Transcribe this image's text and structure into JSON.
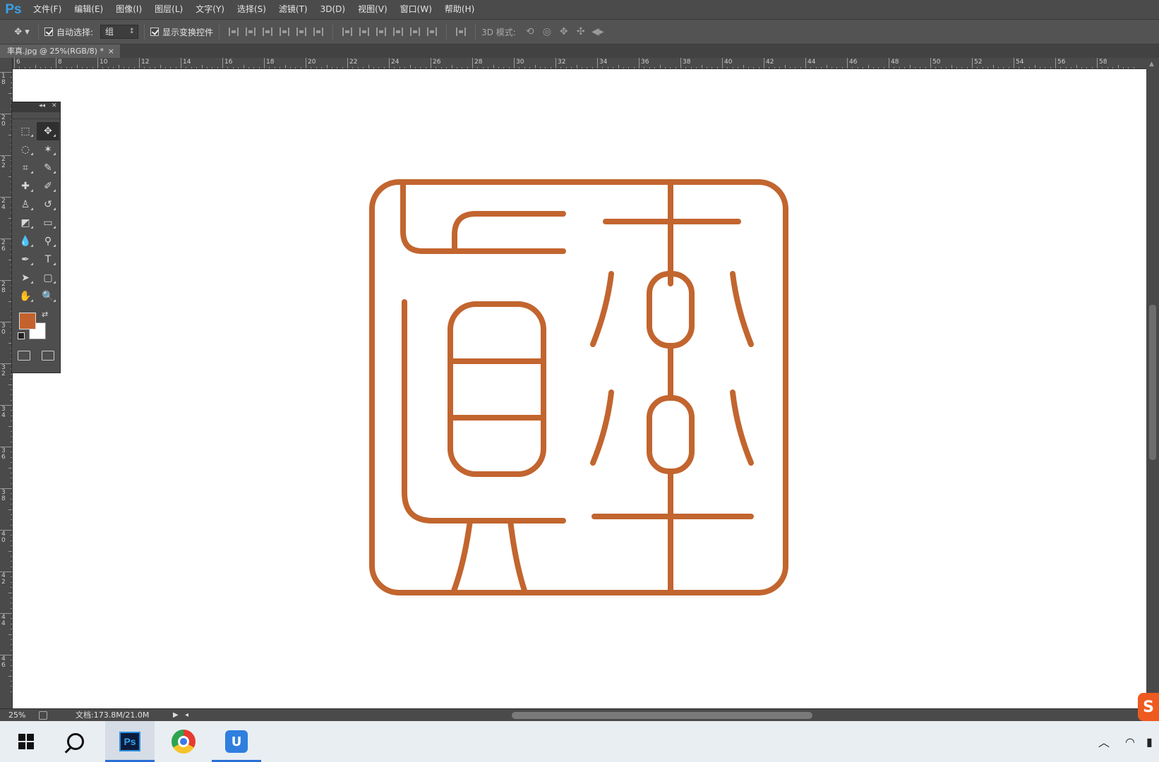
{
  "app": {
    "logo": "Ps",
    "menus": [
      "文件(F)",
      "编辑(E)",
      "图像(I)",
      "图层(L)",
      "文字(Y)",
      "选择(S)",
      "滤镜(T)",
      "3D(D)",
      "视图(V)",
      "窗口(W)",
      "帮助(H)"
    ]
  },
  "options": {
    "auto_select_label": "自动选择:",
    "auto_select_value": "组",
    "show_transform_label": "显示变换控件",
    "mode3d_label": "3D 模式:"
  },
  "document": {
    "tab_title": "率真.jpg @ 25%(RGB/8) *",
    "tab_close": "×"
  },
  "rulers": {
    "horizontal": [
      "6",
      "8",
      "10",
      "12",
      "14",
      "16",
      "18",
      "20",
      "22",
      "24",
      "26",
      "28",
      "30",
      "32",
      "34",
      "36",
      "38",
      "40",
      "42",
      "44",
      "46",
      "48",
      "50",
      "52",
      "54",
      "56",
      "58"
    ],
    "vertical": [
      "18",
      "20",
      "22",
      "24",
      "26",
      "28",
      "30",
      "32",
      "34",
      "36",
      "38",
      "40",
      "42",
      "44",
      "46"
    ]
  },
  "colors": {
    "seal": "#c2652f",
    "foreground": "#c4622e",
    "background": "#ffffff",
    "ui_dark": "#535353",
    "accent_blue": "#2a6fd6"
  },
  "tools": [
    {
      "name": "marquee-tool-icon",
      "glyph": "⬚"
    },
    {
      "name": "move-tool-icon",
      "glyph": "✥",
      "active": true
    },
    {
      "name": "lasso-tool-icon",
      "glyph": "◌"
    },
    {
      "name": "magic-wand-tool-icon",
      "glyph": "✶"
    },
    {
      "name": "crop-tool-icon",
      "glyph": "⌗"
    },
    {
      "name": "eyedropper-tool-icon",
      "glyph": "✎"
    },
    {
      "name": "healing-brush-tool-icon",
      "glyph": "✚"
    },
    {
      "name": "brush-tool-icon",
      "glyph": "✐"
    },
    {
      "name": "clone-stamp-tool-icon",
      "glyph": "♙"
    },
    {
      "name": "history-brush-tool-icon",
      "glyph": "↺"
    },
    {
      "name": "eraser-tool-icon",
      "glyph": "◩"
    },
    {
      "name": "gradient-tool-icon",
      "glyph": "▭"
    },
    {
      "name": "blur-tool-icon",
      "glyph": "💧"
    },
    {
      "name": "dodge-tool-icon",
      "glyph": "⚲"
    },
    {
      "name": "pen-tool-icon",
      "glyph": "✒"
    },
    {
      "name": "type-tool-icon",
      "glyph": "T"
    },
    {
      "name": "path-selection-tool-icon",
      "glyph": "➤"
    },
    {
      "name": "shape-tool-icon",
      "glyph": "▢"
    },
    {
      "name": "hand-tool-icon",
      "glyph": "✋"
    },
    {
      "name": "zoom-tool-icon",
      "glyph": "🔍"
    }
  ],
  "status": {
    "zoom": "25%",
    "doc_info": "文档:173.8M/21.0M"
  },
  "taskbar": {
    "ps_label": "Ps",
    "u_label": "U",
    "sogou_label": "S"
  }
}
